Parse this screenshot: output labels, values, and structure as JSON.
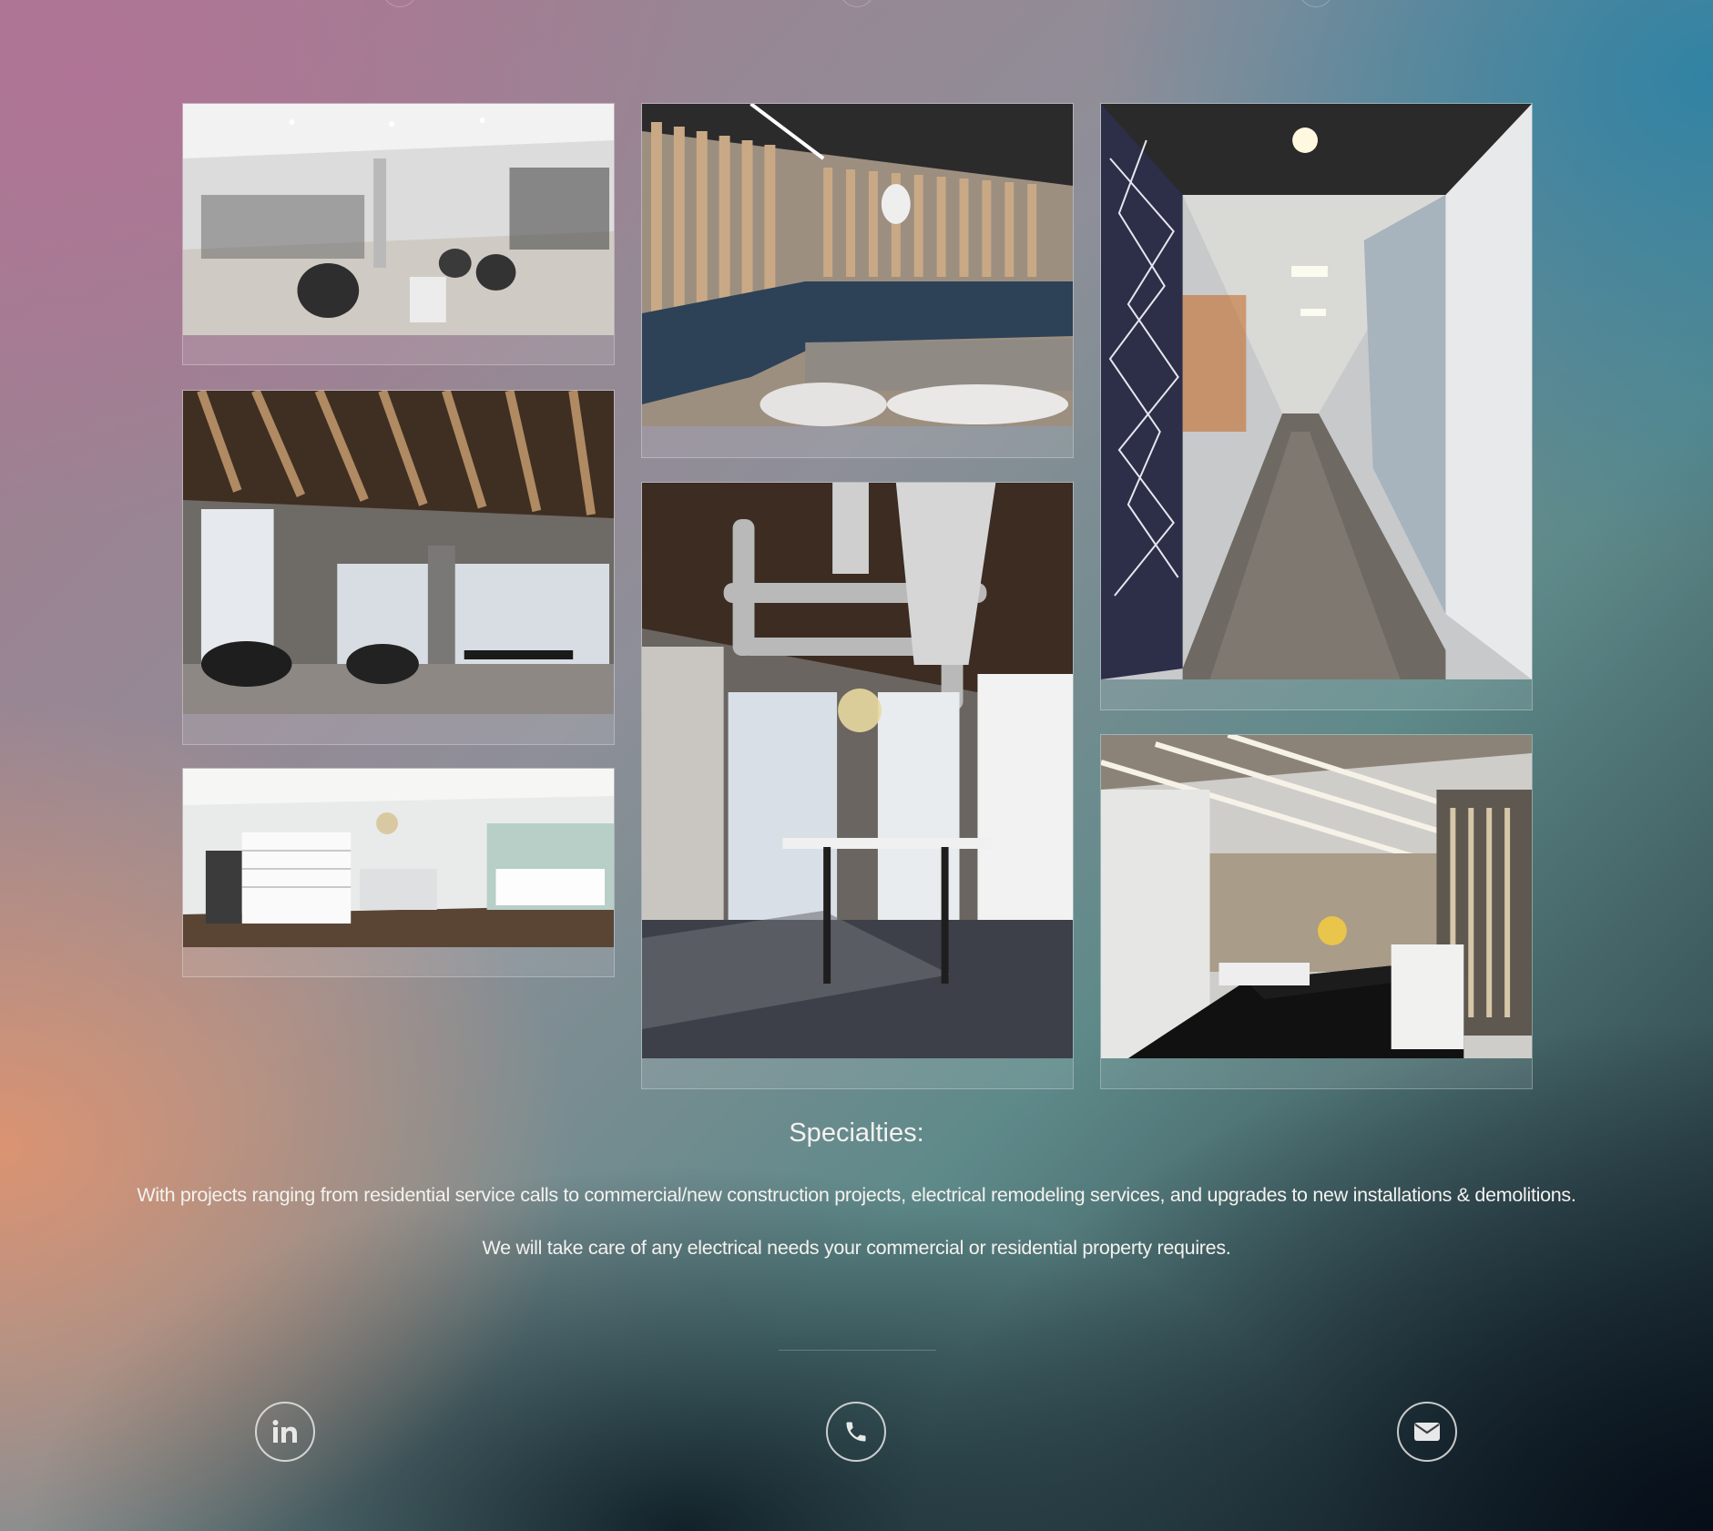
{
  "gallery": {
    "photos": [
      {
        "name": "salon-interior-photo",
        "alt": "Salon interior"
      },
      {
        "name": "lounge-booth-photo",
        "alt": "Lounge booth with slatted wood walls"
      },
      {
        "name": "corridor-photo",
        "alt": "Office corridor with map mural"
      },
      {
        "name": "dining-area-photo",
        "alt": "Dining area with wood ceiling slats"
      },
      {
        "name": "exposed-ducts-photo",
        "alt": "Open space with exposed ducts"
      },
      {
        "name": "boutique-interior-photo",
        "alt": "Boutique with shelving"
      },
      {
        "name": "breakroom-kitchen-photo",
        "alt": "Break room kitchen counter"
      }
    ]
  },
  "specialties": {
    "title": "Specialties:",
    "description": "With projects ranging from residential service calls to commercial/new construction projects, electrical remodeling services, and upgrades to new installations & demolitions.",
    "closing": "We will take care of any electrical needs your commercial or residential property requires."
  },
  "social": [
    {
      "icon": "linkedin-icon",
      "label": "in"
    },
    {
      "icon": "phone-icon"
    },
    {
      "icon": "email-icon"
    }
  ],
  "colors": {
    "text": "#f4f2ef",
    "icon_border": "#e6e6e6"
  }
}
